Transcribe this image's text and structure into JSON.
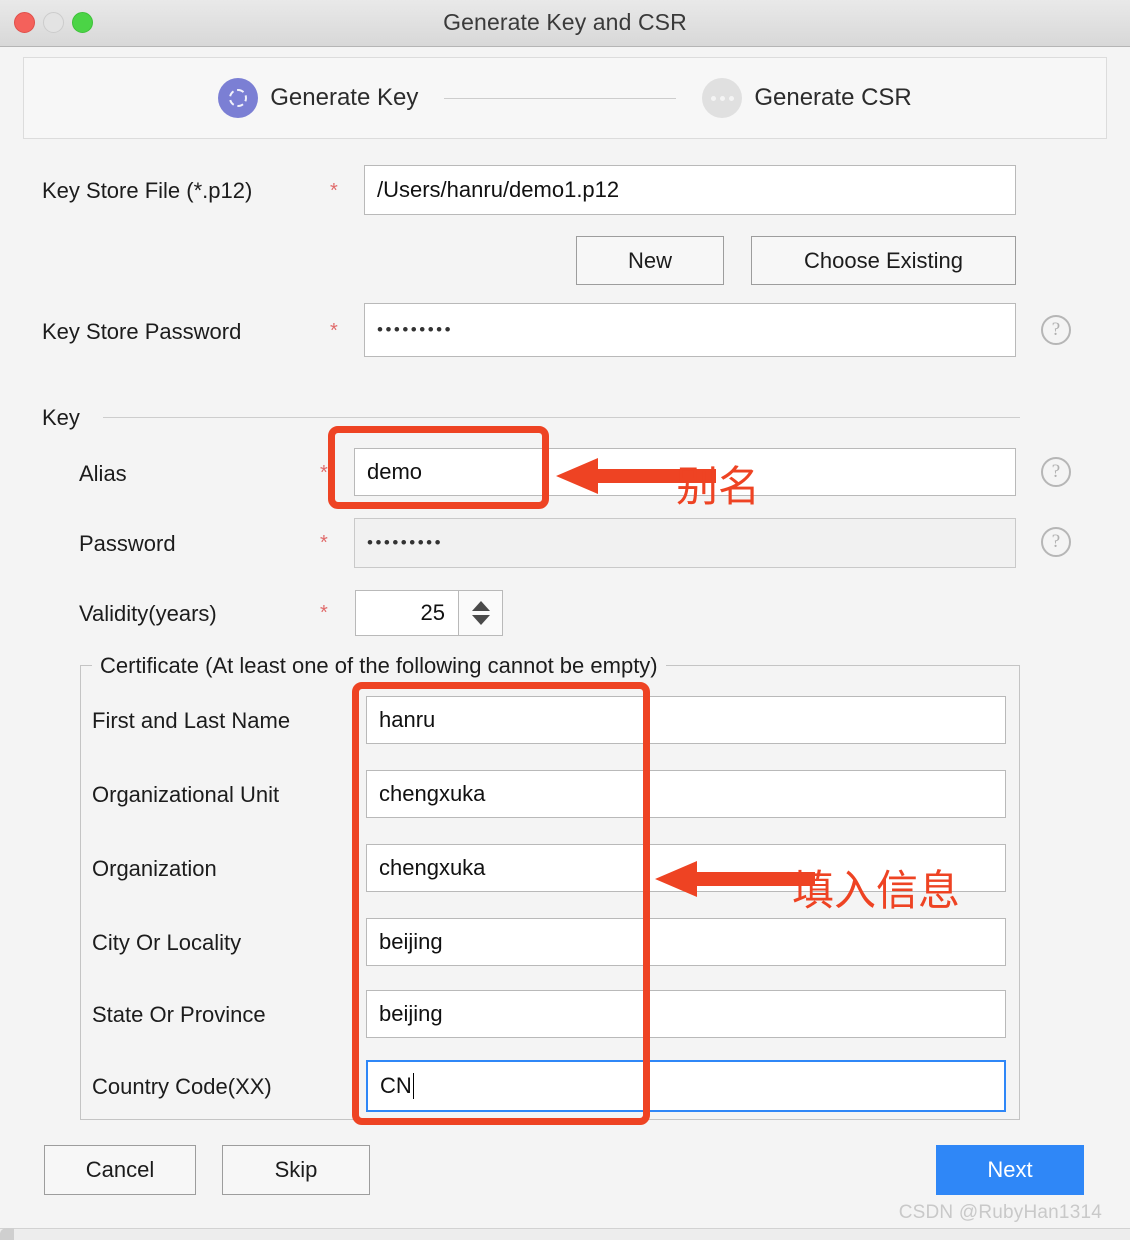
{
  "window": {
    "title": "Generate Key and CSR",
    "traffic_lights": [
      "close",
      "minimize",
      "zoom"
    ]
  },
  "steps": [
    {
      "label": "Generate Key",
      "state": "active",
      "icon": "dashed-ring-icon"
    },
    {
      "label": "Generate CSR",
      "state": "inactive",
      "icon": "ellipsis-icon"
    }
  ],
  "keystore": {
    "file_label": "Key Store File (*.p12)",
    "file_required": "*",
    "file_value": "/Users/hanru/demo1.p12",
    "new_button": "New",
    "choose_existing_button": "Choose Existing",
    "password_label": "Key Store Password",
    "password_required": "*",
    "password_value": "•••••••••",
    "help_icon": "question-mark-icon"
  },
  "key_group": {
    "title": "Key",
    "alias_label": "Alias",
    "alias_required": "*",
    "alias_value": "demo",
    "password_label": "Password",
    "password_required": "*",
    "password_value": "•••••••••",
    "validity_label": "Validity(years)",
    "validity_required": "*",
    "validity_value": "25"
  },
  "certificate": {
    "legend": "Certificate (At least one of the following cannot be empty)",
    "fields": [
      {
        "label": "First and Last Name",
        "value": "hanru",
        "focused": false
      },
      {
        "label": "Organizational Unit",
        "value": "chengxuka",
        "focused": false
      },
      {
        "label": "Organization",
        "value": "chengxuka",
        "focused": false
      },
      {
        "label": "City Or Locality",
        "value": "beijing",
        "focused": false
      },
      {
        "label": "State Or Province",
        "value": "beijing",
        "focused": false
      },
      {
        "label": "Country Code(XX)",
        "value": "CN",
        "focused": true
      }
    ]
  },
  "footer": {
    "cancel": "Cancel",
    "skip": "Skip",
    "next": "Next"
  },
  "annotations": {
    "alias_note": "别名",
    "certificate_note": "填入信息",
    "color": "#ee4323"
  },
  "watermark": "CSDN @RubyHan1314",
  "colors": {
    "accent_primary": "#2f87f7",
    "step_active": "#7b7fd4",
    "required_star": "#e06a6a",
    "annotation_red": "#ee4323",
    "focus_blue": "#2f87f7"
  }
}
